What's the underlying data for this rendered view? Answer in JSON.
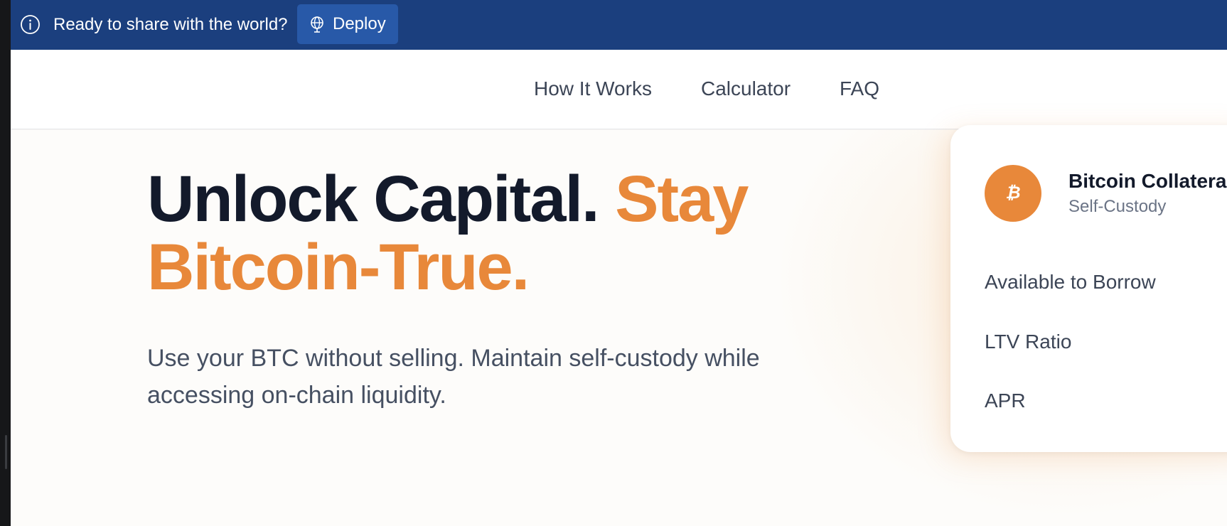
{
  "banner": {
    "message": "Ready to share with the world?",
    "deploy_label": "Deploy",
    "background_color": "#1b3f7e",
    "button_color": "#2859a8"
  },
  "nav": {
    "links": [
      {
        "label": "How It Works"
      },
      {
        "label": "Calculator"
      },
      {
        "label": "FAQ"
      }
    ]
  },
  "hero": {
    "headline_part1": "Unlock Capital.",
    "headline_part2": "Stay",
    "headline_part3": "Bitcoin-True.",
    "subtext": "Use your BTC without selling. Maintain self-custody while accessing on-chain liquidity.",
    "accent_color": "#e8883a",
    "dark_color": "#131a2b"
  },
  "card": {
    "icon": "bitcoin-icon",
    "icon_glyph": "₿",
    "title": "Bitcoin Collateral",
    "subtitle": "Self-Custody",
    "rows": [
      {
        "label": "Available to Borrow"
      },
      {
        "label": "LTV Ratio"
      },
      {
        "label": "APR"
      }
    ]
  }
}
